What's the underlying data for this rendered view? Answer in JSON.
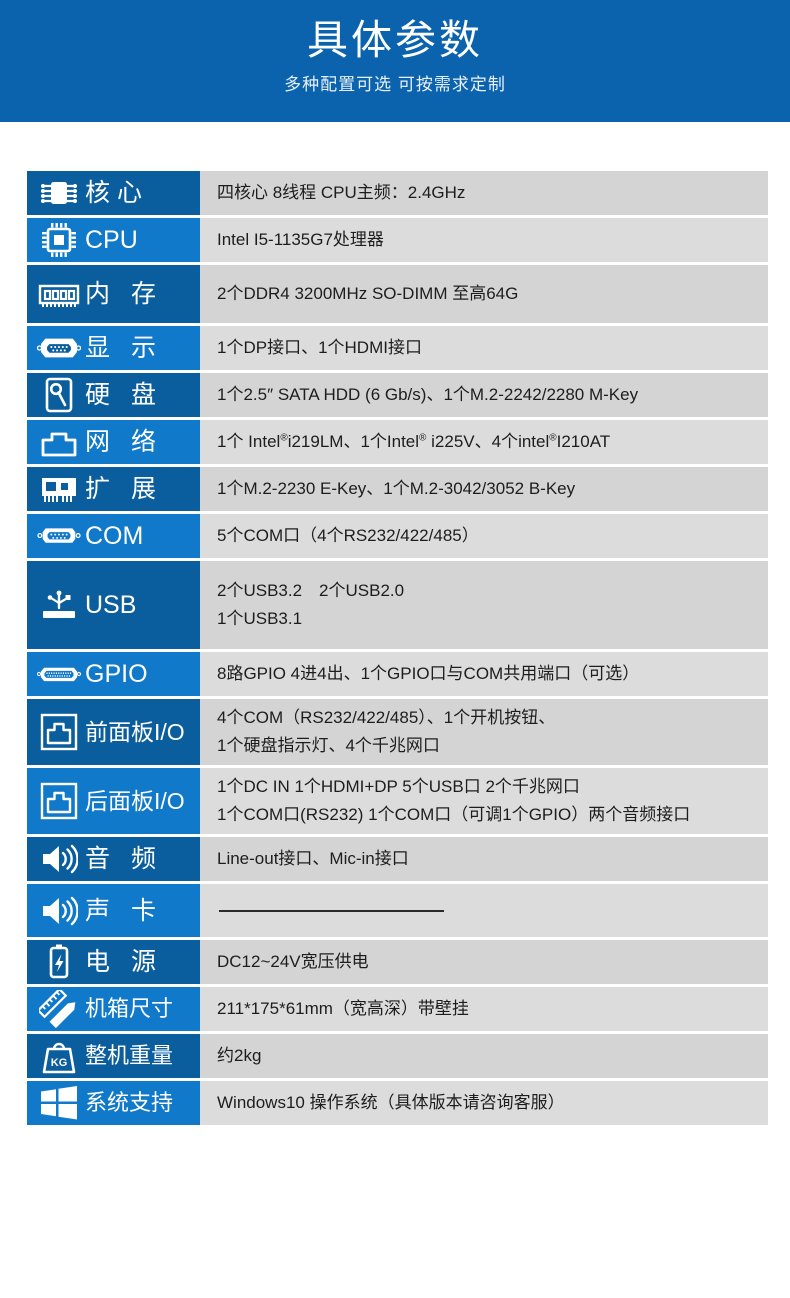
{
  "header": {
    "title": "具体参数",
    "subtitle": "多种配置可选 可按需求定制",
    "bg_color": "#0b63ae"
  },
  "colors": {
    "label_dark": "#0b5e9e",
    "label_light": "#1179c9",
    "value_grey_a": "#d4d4d4",
    "value_grey_b": "#dcdcdc",
    "label_text": "#ffffff",
    "value_text": "#1d1d1d"
  },
  "spec_rows": [
    {
      "icon": "ic-chip-icon",
      "label": "核心",
      "label_style": "wide",
      "value_lines": [
        "四核心 8线程 CPU主频：2.4GHz"
      ]
    },
    {
      "icon": "cpu-icon",
      "label": "CPU",
      "label_style": "narrow",
      "value_lines": [
        "Intel I5-1135G7处理器"
      ]
    },
    {
      "icon": "ram-module-icon",
      "label": "内 存",
      "label_style": "wide",
      "value_lines": [
        "2个DDR4 3200MHz SO-DIMM 至高64G"
      ]
    },
    {
      "icon": "vga-port-icon",
      "label": "显 示",
      "label_style": "wide",
      "value_lines": [
        "1个DP接口、1个HDMI接口"
      ]
    },
    {
      "icon": "hard-disk-icon",
      "label": "硬 盘",
      "label_style": "wide",
      "value_lines": [
        "1个2.5″ SATA HDD (6 Gb/s)、1个M.2-2242/2280 M-Key"
      ]
    },
    {
      "icon": "network-port-icon",
      "label": "网 络",
      "label_style": "wide",
      "value_html": "1个 Intel<sup>®</sup>i219LM、1个Intel<sup>®</sup> i225V、4个intel<sup>®</sup>I210AT"
    },
    {
      "icon": "expansion-card-icon",
      "label": "扩 展",
      "label_style": "wide",
      "value_lines": [
        "1个M.2-2230 E-Key、1个M.2-3042/3052 B-Key"
      ]
    },
    {
      "icon": "com-port-icon",
      "label": "COM",
      "label_style": "narrow",
      "value_lines": [
        "5个COM口（4个RS232/422/485）"
      ]
    },
    {
      "icon": "usb-icon",
      "label": "USB",
      "label_style": "narrow",
      "value_lines": [
        "2个USB3.2　2个USB2.0",
        "1个USB3.1"
      ]
    },
    {
      "icon": "gpio-connector-icon",
      "label": "GPIO",
      "label_style": "narrow",
      "value_lines": [
        "8路GPIO 4进4出、1个GPIO口与COM共用端口（可选）"
      ]
    },
    {
      "icon": "panel-port-icon",
      "label": "前面板I/O",
      "label_style": "small",
      "value_lines": [
        "4个COM（RS232/422/485）、1个开机按钮、",
        "1个硬盘指示灯、4个千兆网口"
      ]
    },
    {
      "icon": "panel-port-icon",
      "label": "后面板I/O",
      "label_style": "small",
      "value_lines": [
        "1个DC IN 1个HDMI+DP 5个USB口 2个千兆网口",
        "1个COM口(RS232) 1个COM口（可调1个GPIO）两个音频接口"
      ]
    },
    {
      "icon": "speaker-icon",
      "label": "音 频",
      "label_style": "wide",
      "value_lines": [
        "Line-out接口、Mic-in接口"
      ]
    },
    {
      "icon": "speaker-icon",
      "label": "声 卡",
      "label_style": "wide",
      "value_lines": [
        ""
      ],
      "value_is_rule": true
    },
    {
      "icon": "battery-power-icon",
      "label": "电 源",
      "label_style": "wide",
      "value_lines": [
        "DC12~24V宽压供电"
      ]
    },
    {
      "icon": "ruler-pencil-icon",
      "label": "机箱尺寸",
      "label_style": "smaller",
      "value_lines": [
        "211*175*61mm（宽高深）带壁挂"
      ]
    },
    {
      "icon": "weight-kg-icon",
      "label": "整机重量",
      "label_style": "smaller",
      "value_lines": [
        "约2kg"
      ]
    },
    {
      "icon": "windows-logo-icon",
      "label": "系统支持",
      "label_style": "smaller",
      "value_lines": [
        "Windows10 操作系统（具体版本请咨询客服）"
      ]
    }
  ]
}
